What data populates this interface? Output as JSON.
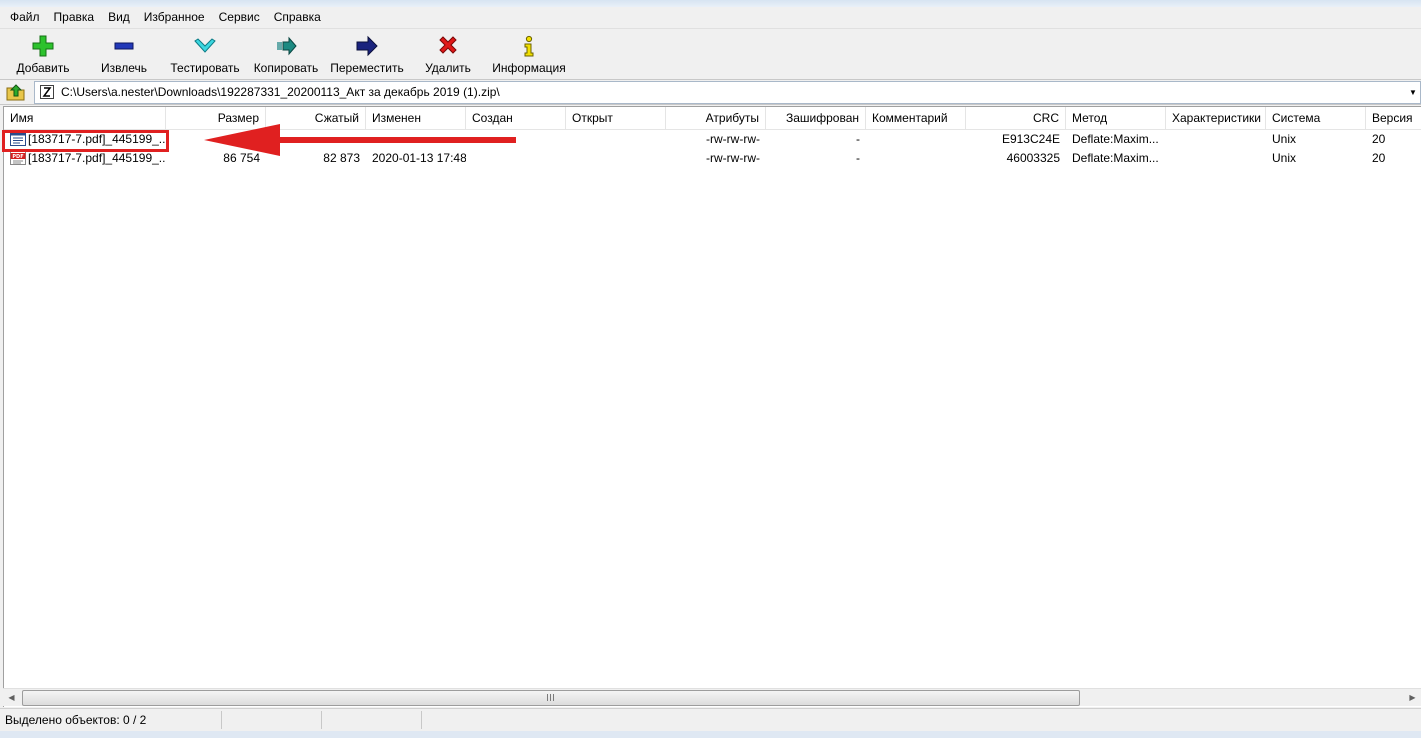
{
  "menu": {
    "items": [
      "Файл",
      "Правка",
      "Вид",
      "Избранное",
      "Сервис",
      "Справка"
    ]
  },
  "toolbar": {
    "add_label": "Добавить",
    "extract_label": "Извлечь",
    "test_label": "Тестировать",
    "copy_label": "Копировать",
    "move_label": "Переместить",
    "delete_label": "Удалить",
    "info_label": "Информация",
    "icons": {
      "add": "plus-icon",
      "extract": "minus-icon",
      "test": "checkmark-icon",
      "copy": "copy-arrow-icon",
      "move": "move-arrow-icon",
      "delete": "delete-x-icon",
      "info": "info-icon"
    }
  },
  "address": {
    "path": "C:\\Users\\a.nester\\Downloads\\192287331_20200113_Акт за декабрь 2019 (1).zip\\"
  },
  "columns": {
    "name": "Имя",
    "size": "Размер",
    "packed": "Сжатый",
    "modified": "Изменен",
    "created": "Создан",
    "accessed": "Открыт",
    "attributes": "Атрибуты",
    "encrypted": "Зашифрован",
    "comment": "Комментарий",
    "crc": "CRC",
    "method": "Метод",
    "characteristics": "Характеристики",
    "host_os": "Система",
    "version": "Версия"
  },
  "files": [
    {
      "name": "[183717-7.pdf]_445199_...",
      "icon": "text-file-icon",
      "size": "",
      "packed": "",
      "modified": "",
      "created": "",
      "accessed": "",
      "attributes": "-rw-rw-rw-",
      "encrypted": "-",
      "comment": "",
      "crc": "E913C24E",
      "method": "Deflate:Maxim...",
      "characteristics": "",
      "host_os": "Unix",
      "version": "20"
    },
    {
      "name": "[183717-7.pdf]_445199_...",
      "icon": "pdf-file-icon",
      "size": "86 754",
      "packed": "82 873",
      "modified": "2020-01-13 17:48",
      "created": "",
      "accessed": "",
      "attributes": "-rw-rw-rw-",
      "encrypted": "-",
      "comment": "",
      "crc": "46003325",
      "method": "Deflate:Maxim...",
      "characteristics": "",
      "host_os": "Unix",
      "version": "20"
    }
  ],
  "status": {
    "selected": "Выделено объектов: 0 / 2"
  },
  "annotation": {
    "color": "#e02020"
  }
}
